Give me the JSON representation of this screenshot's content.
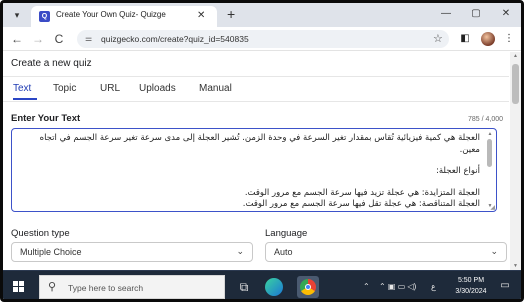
{
  "browser": {
    "tab_title": "Create Your Own Quiz- Quizge",
    "tab_close": "✕",
    "new_tab": "+",
    "url": "quizgecko.com/create?quiz_id=540835",
    "window_controls": {
      "minimize": "—",
      "maximize": "▢",
      "close": "✕"
    },
    "icons": [
      "chevron-down-icon",
      "favicon-icon",
      "back-icon",
      "forward-icon",
      "reload-icon",
      "site-info-icon",
      "star-icon",
      "sidebar-icon",
      "profile-avatar",
      "menu-icon"
    ]
  },
  "page": {
    "title": "Create a new quiz",
    "tabs": [
      {
        "label": "Text",
        "active": true
      },
      {
        "label": "Topic",
        "active": false
      },
      {
        "label": "URL",
        "active": false
      },
      {
        "label": "Uploads",
        "active": false
      },
      {
        "label": "Manual",
        "active": false
      }
    ],
    "enter_text_label": "Enter Your Text",
    "char_counter": "785 / 4,000",
    "text_lines": [
      "العجلة هي كمية فيزيائية تُقاس بمقدار تغير السرعة في وحدة الزمن. تُشير العجلة إلى مدى سرعة تغير سرعة الجسم في اتجاه معين.",
      "أنواع العجلة:",
      "العجلة المتزايدة: هي عجلة تزيد فيها سرعة الجسم مع مرور الوقت.",
      "العجلة المتناقصة: هي عجلة تقل فيها سرعة الجسم مع مرور الوقت."
    ],
    "question_type_label": "Question type",
    "question_type_value": "Multiple Choice",
    "language_label": "Language",
    "language_value": "Auto"
  },
  "taskbar": {
    "search_placeholder": "Type here to search",
    "time": "5:50 PM",
    "date": "3/30/2024",
    "icons": [
      "windows-start-icon",
      "search-icon",
      "task-view-icon",
      "file-explorer-icon",
      "edge-icon",
      "chrome-icon",
      "tray-chevron-icon",
      "network-icon",
      "volume-icon",
      "notification-icon"
    ]
  },
  "colors": {
    "accent": "#2b46c5",
    "taskbar": "#1e2a3a",
    "tabstrip": "#dfe3ea"
  }
}
